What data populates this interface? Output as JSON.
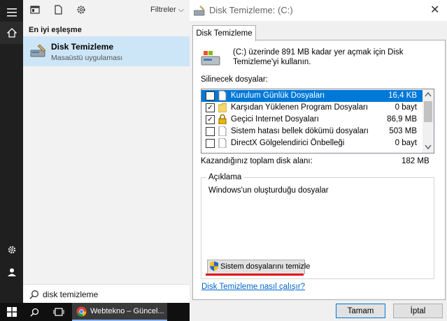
{
  "start_panel": {
    "filters_label": "Filtreler",
    "best_match_label": "En iyi eşleşme",
    "result": {
      "title": "Disk Temizleme",
      "subtitle": "Masaüstü uygulaması"
    },
    "search_query": "disk temizleme"
  },
  "taskbar": {
    "chrome_label": "Webtekno – Güncel..."
  },
  "dialog": {
    "title": "Disk Temizleme:  (C:)",
    "tab_label": "Disk Temizleme",
    "intro": "(C:) üzerinde 891 MB kadar yer açmak için Disk Temizleme'yi kullanın.",
    "files_label": "Silinecek dosyalar:",
    "files": [
      {
        "checked": false,
        "name": "Kurulum Günlük Dosyaları",
        "size": "16,4 KB",
        "selected": true
      },
      {
        "checked": true,
        "name": "Karşıdan Yüklenen Program Dosyaları",
        "size": "0 bayt",
        "selected": false
      },
      {
        "checked": true,
        "name": "Geçici Internet Dosyaları",
        "size": "86,9 MB",
        "selected": false
      },
      {
        "checked": false,
        "name": "Sistem hatası bellek dökümü dosyaları",
        "size": "503 MB",
        "selected": false
      },
      {
        "checked": false,
        "name": "DirectX Gölgelendirici Önbelleği",
        "size": "0 bayt",
        "selected": false
      }
    ],
    "total_label": "Kazandığınız toplam disk alanı:",
    "total_value": "182 MB",
    "description_legend": "Açıklama",
    "description_text": "Windows'un oluşturduğu dosyalar",
    "system_button_label": "Sistem dosyalarını temizle",
    "help_link": "Disk Temizleme nasıl çalışır?",
    "ok_label": "Tamam",
    "cancel_label": "İptal"
  },
  "colors": {
    "accent": "#0078d7",
    "highlight": "#cde6f7",
    "annotation_red": "#e0101a"
  }
}
